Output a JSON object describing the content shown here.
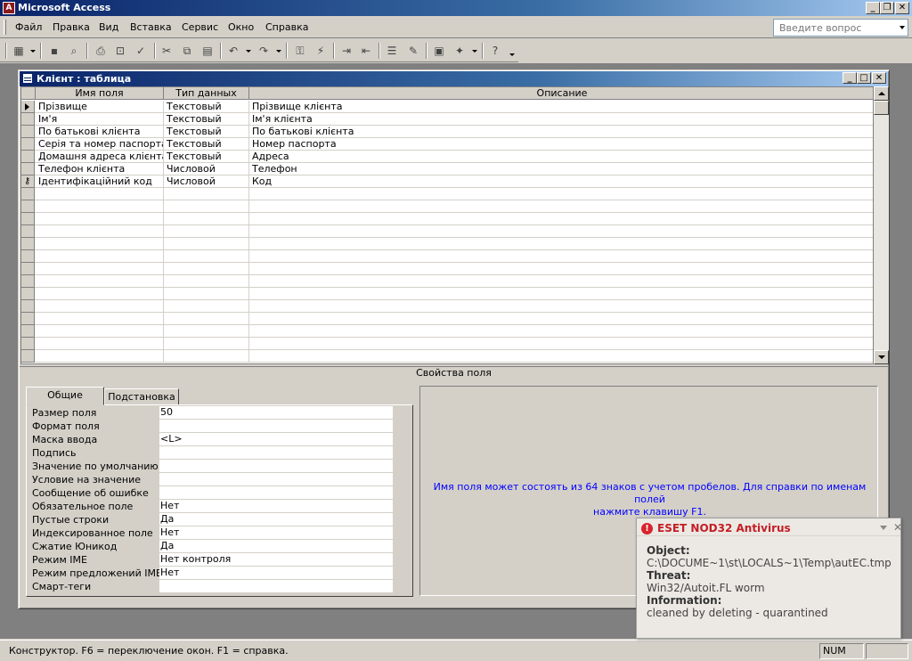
{
  "window": {
    "title": "Microsoft Access"
  },
  "menu": {
    "items": [
      "Файл",
      "Правка",
      "Вид",
      "Вставка",
      "Сервис",
      "Окно",
      "Справка"
    ],
    "ask_placeholder": "Введите вопрос"
  },
  "table_window": {
    "title": "Клієнт : таблица",
    "columns": [
      "Имя поля",
      "Тип данных",
      "Описание"
    ],
    "rows": [
      {
        "name": "Прізвище",
        "type": "Текстовый",
        "desc": " Прізвище клієнта"
      },
      {
        "name": "Ім'я",
        "type": "Текстовый",
        "desc": "Ім'я  клієнта"
      },
      {
        "name": "По батькові клієнта",
        "type": "Текстовый",
        "desc": "По батькові клієнта"
      },
      {
        "name": "Серія та номер паспорта клієнта",
        "type": "Текстовый",
        "desc": "Номер паспорта"
      },
      {
        "name": "Домашня адреса клієнта",
        "type": "Текстовый",
        "desc": "Адреса"
      },
      {
        "name": "Телефон клієнта",
        "type": "Числовой",
        "desc": "Телефон"
      },
      {
        "name": "Ідентифікаційний код",
        "type": "Числовой",
        "desc": "Код"
      }
    ]
  },
  "field_props": {
    "title": "Свойства поля",
    "tabs": [
      "Общие",
      "Подстановка"
    ],
    "props": [
      {
        "label": "Размер поля",
        "value": "50"
      },
      {
        "label": "Формат поля",
        "value": ""
      },
      {
        "label": "Маска ввода",
        "value": "<L>"
      },
      {
        "label": "Подпись",
        "value": ""
      },
      {
        "label": "Значение по умолчанию",
        "value": ""
      },
      {
        "label": "Условие на значение",
        "value": ""
      },
      {
        "label": "Сообщение об ошибке",
        "value": ""
      },
      {
        "label": "Обязательное поле",
        "value": "Нет"
      },
      {
        "label": "Пустые строки",
        "value": "Да"
      },
      {
        "label": "Индексированное поле",
        "value": "Нет"
      },
      {
        "label": "Сжатие Юникод",
        "value": "Да"
      },
      {
        "label": "Режим IME",
        "value": "Нет контроля"
      },
      {
        "label": "Режим предложений IME",
        "value": "Нет"
      },
      {
        "label": "Смарт-теги",
        "value": ""
      }
    ],
    "help_line1": "Имя поля может состоять из 64 знаков с учетом пробелов.  Для справки по именам полей",
    "help_line2": "нажмите клавишу F1."
  },
  "statusbar": {
    "text": "Конструктор.  F6 = переключение окон.  F1 = справка.",
    "num": "NUM"
  },
  "eset": {
    "title": "ESET NOD32 Antivirus",
    "object_label": "Object:",
    "object_value": "C:\\DOCUME~1\\st\\LOCALS~1\\Temp\\autEC.tmp",
    "threat_label": "Threat:",
    "threat_value": "Win32/Autoit.FL worm",
    "info_label": "Information:",
    "info_value": "cleaned by deleting - quarantined"
  }
}
